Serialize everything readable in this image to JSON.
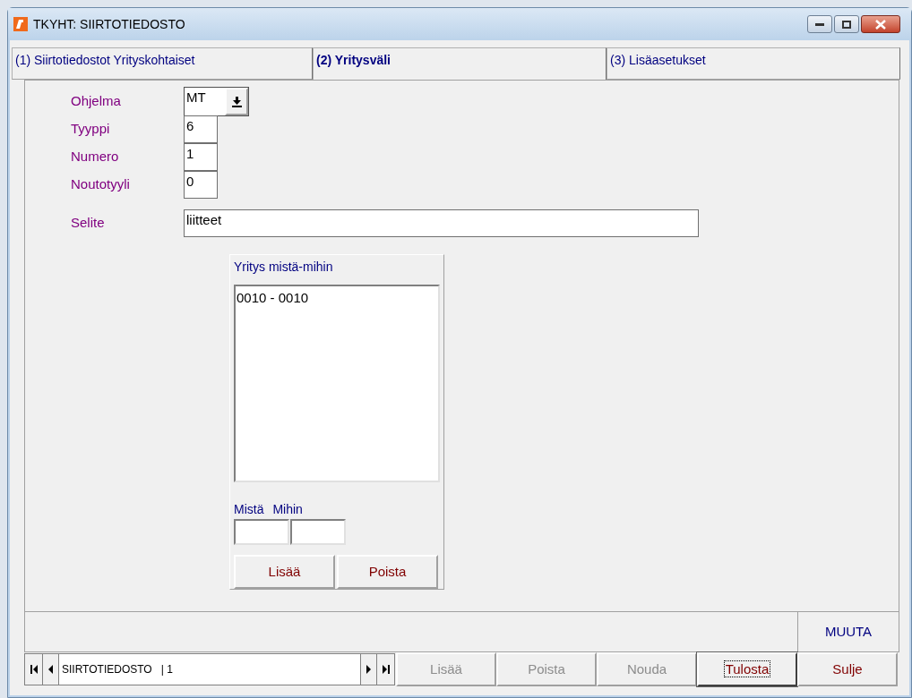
{
  "window": {
    "title": "TKYHT: SIIRTOTIEDOSTO"
  },
  "tabs": [
    {
      "label": "(1) Siirtotiedostot Yrityskohtaiset",
      "selected": false
    },
    {
      "label": "(2) Yritysväli",
      "selected": true
    },
    {
      "label": "(3) Lisäasetukset",
      "selected": false
    }
  ],
  "fields": [
    {
      "label": "Ohjelma",
      "value": "MT",
      "kind": "combo"
    },
    {
      "label": "Tyyppi",
      "value": "6",
      "kind": "short"
    },
    {
      "label": "Numero",
      "value": "1",
      "kind": "short"
    },
    {
      "label": "Noutotyyli",
      "value": "0",
      "kind": "short"
    },
    {
      "label": "Selite",
      "value": "liitteet",
      "kind": "wide"
    }
  ],
  "range_group": {
    "title": "Yritys mistä-mihin",
    "items": [
      "0010 - 0010"
    ],
    "from_label": "Mistä",
    "to_label": "Mihin",
    "buttons": [
      "Lisää",
      "Poista"
    ]
  },
  "status_bar": {
    "mode": "MUUTA"
  },
  "navigator": {
    "text": "SIIRTOTIEDOSTO   | 1"
  },
  "buttons": [
    {
      "label": "Lisää",
      "disabled": true,
      "focused": false
    },
    {
      "label": "Poista",
      "disabled": true,
      "focused": false
    },
    {
      "label": "Nouda",
      "disabled": true,
      "focused": false
    },
    {
      "label": "Tulosta",
      "disabled": false,
      "focused": true
    },
    {
      "label": "Sulje",
      "disabled": false,
      "focused": false
    }
  ]
}
